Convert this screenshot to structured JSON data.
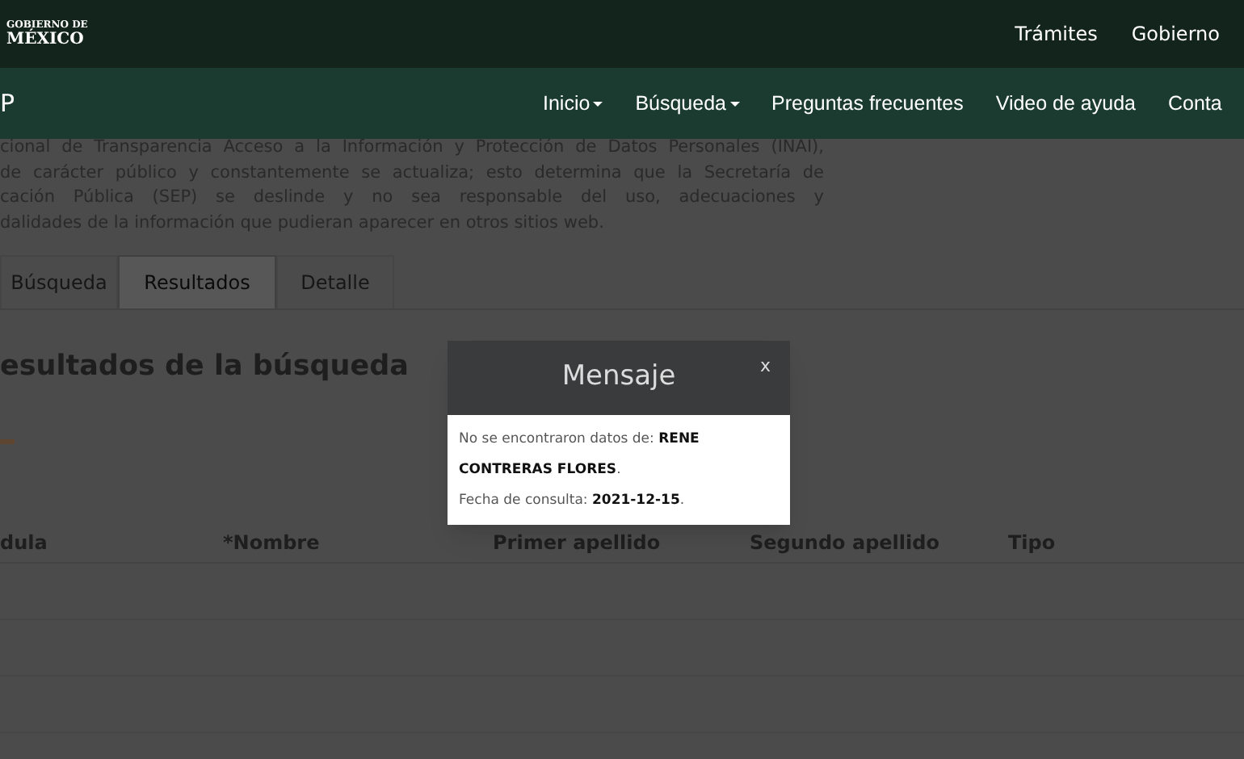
{
  "top_bar": {
    "logo_small": "GOBIERNO DE",
    "logo_large": "MÉXICO",
    "links": [
      "Trámites",
      "Gobierno"
    ]
  },
  "nav": {
    "brand": "P",
    "items": [
      {
        "label": "Inicio",
        "dropdown": true
      },
      {
        "label": "Búsqueda",
        "dropdown": true
      },
      {
        "label": "Preguntas frecuentes",
        "dropdown": false
      },
      {
        "label": "Video de ayuda",
        "dropdown": false
      },
      {
        "label": "Conta",
        "dropdown": false
      }
    ]
  },
  "intro_lines": [
    "cional de Transparencia Acceso a la Información y Protección de Datos Personales (INAI),",
    "de carácter público y constantemente se actualiza; esto determina que la Secretaría de",
    "cación Pública (SEP) se deslinde y no sea responsable del uso, adecuaciones y",
    "dalidades de la información que pudieran aparecer en otros sitios web."
  ],
  "tabs": [
    {
      "label": "Búsqueda",
      "selected": false
    },
    {
      "label": "Resultados",
      "selected": true
    },
    {
      "label": "Detalle",
      "selected": false
    }
  ],
  "heading": "esultados de la búsqueda",
  "table": {
    "columns": [
      "dula",
      "*Nombre",
      "Primer apellido",
      "Segundo apellido",
      "Tipo"
    ]
  },
  "dialog": {
    "title": "Mensaje",
    "close": "x",
    "lines": [
      "No se encontraron datos de: **RENE CONTRERAS FLORES**.",
      "Fecha de consulta: **2021-12-15**."
    ]
  }
}
